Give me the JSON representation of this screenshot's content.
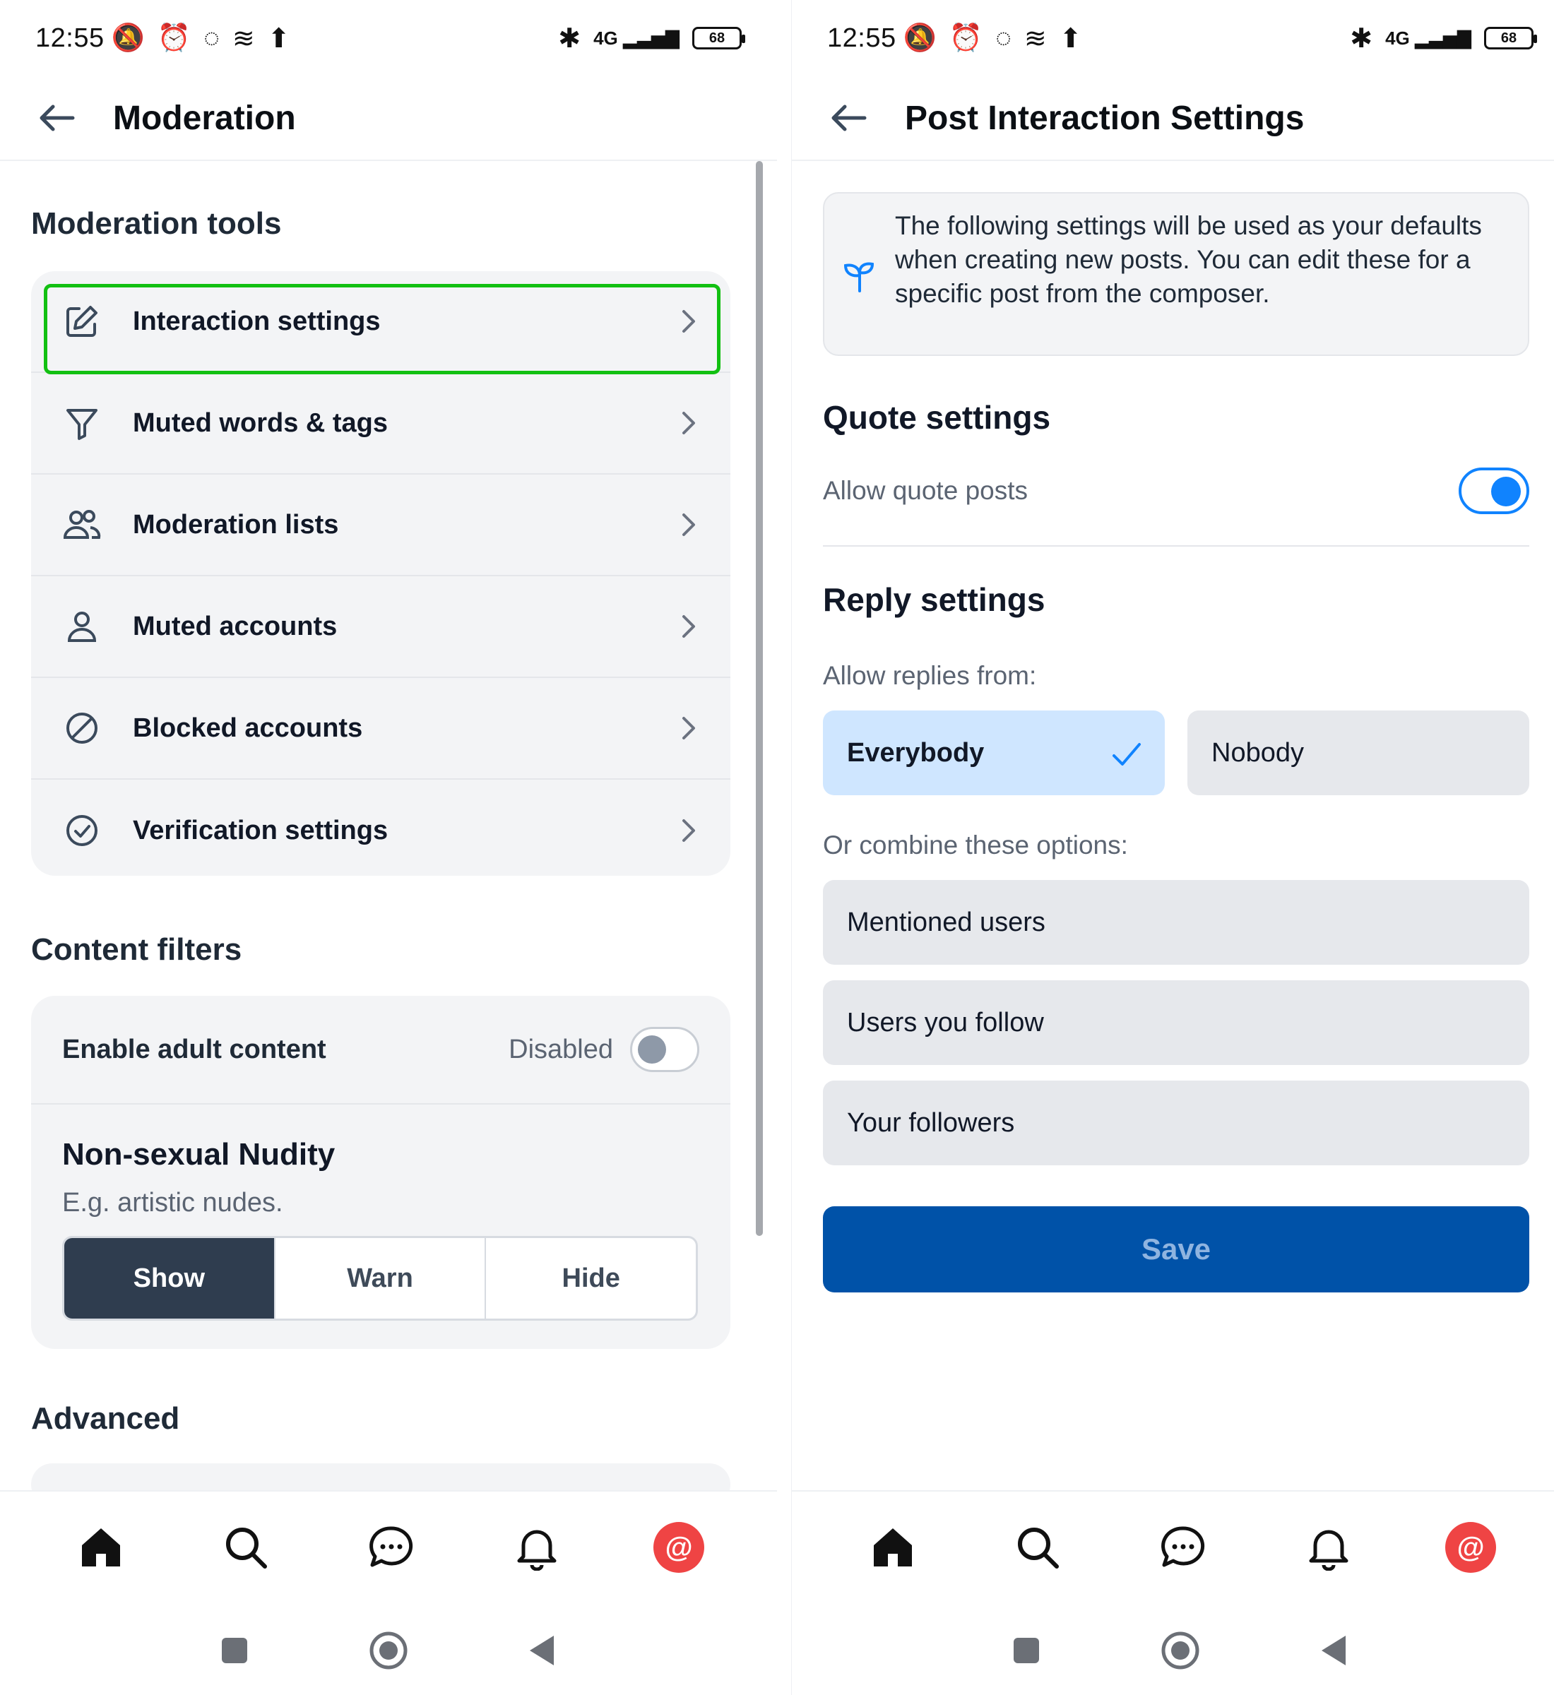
{
  "status_bar": {
    "time": "12:55",
    "network": "4G",
    "battery": "68"
  },
  "left": {
    "header_title": "Moderation",
    "moderation_tools": {
      "title": "Moderation tools",
      "items": [
        {
          "label": "Interaction settings",
          "icon": "edit-icon"
        },
        {
          "label": "Muted words & tags",
          "icon": "filter-icon"
        },
        {
          "label": "Moderation lists",
          "icon": "users-icon"
        },
        {
          "label": "Muted accounts",
          "icon": "person-icon"
        },
        {
          "label": "Blocked accounts",
          "icon": "blocked-icon"
        },
        {
          "label": "Verification settings",
          "icon": "check-circle-icon"
        }
      ]
    },
    "content_filters": {
      "title": "Content filters",
      "adult_label": "Enable adult content",
      "adult_state": "Disabled",
      "nudity_title": "Non-sexual Nudity",
      "nudity_sub": "E.g. artistic nudes.",
      "options": [
        "Show",
        "Warn",
        "Hide"
      ],
      "selected": "Show"
    },
    "advanced_title": "Advanced"
  },
  "right": {
    "header_title": "Post Interaction Settings",
    "notice": "The following settings will be used as your defaults when creating new posts. You can edit these for a specific post from the composer.",
    "quote": {
      "title": "Quote settings",
      "label": "Allow quote posts",
      "enabled": true
    },
    "reply": {
      "title": "Reply settings",
      "allow_from_label": "Allow replies from:",
      "everybody": "Everybody",
      "nobody": "Nobody",
      "combine_label": "Or combine these options:",
      "options": [
        "Mentioned users",
        "Users you follow",
        "Your followers"
      ]
    },
    "save_label": "Save"
  },
  "avatar_glyph": "@",
  "colors": {
    "accent": "#1083fe",
    "save": "#0052a8",
    "highlight": "#12c012",
    "avatar": "#ef4444"
  }
}
